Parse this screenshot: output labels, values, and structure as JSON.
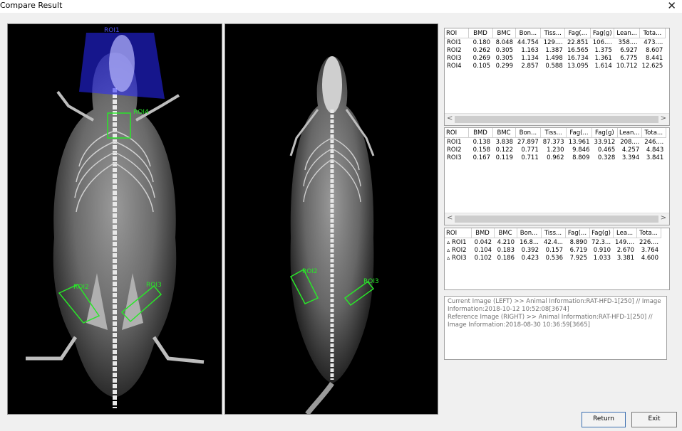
{
  "window": {
    "title": "Compare Result",
    "close_glyph": "✕"
  },
  "images": {
    "left_rois": [
      "ROI1",
      "ROI2",
      "ROI3",
      "ROI4"
    ],
    "right_rois": [
      "ROI2",
      "ROI3"
    ]
  },
  "tables": [
    {
      "columns": [
        "ROI",
        "BMD",
        "BMC",
        "Bon...",
        "Tiss...",
        "Fag(...",
        "Fag(g)",
        "Lean...",
        "Tota..."
      ],
      "rows": [
        [
          "ROI1",
          "0.180",
          "8.048",
          "44.754",
          "129....",
          "22.851",
          "106....",
          "358....",
          "473...."
        ],
        [
          "ROI2",
          "0.262",
          "0.305",
          "1.163",
          "1.387",
          "16.565",
          "1.375",
          "6.927",
          "8.607"
        ],
        [
          "ROI3",
          "0.269",
          "0.305",
          "1.134",
          "1.498",
          "16.734",
          "1.361",
          "6.775",
          "8.441"
        ],
        [
          "ROI4",
          "0.105",
          "0.299",
          "2.857",
          "0.588",
          "13.095",
          "1.614",
          "10.712",
          "12.625"
        ]
      ]
    },
    {
      "columns": [
        "ROI",
        "BMD",
        "BMC",
        "Bon...",
        "Tiss...",
        "Fag(...",
        "Fag(g)",
        "Lean...",
        "Tota..."
      ],
      "rows": [
        [
          "ROI1",
          "0.138",
          "3.838",
          "27.897",
          "87.373",
          "13.961",
          "33.912",
          "208....",
          "246...."
        ],
        [
          "ROI2",
          "0.158",
          "0.122",
          "0.771",
          "1.230",
          "9.846",
          "0.465",
          "4.257",
          "4.843"
        ],
        [
          "ROI3",
          "0.167",
          "0.119",
          "0.711",
          "0.962",
          "8.809",
          "0.328",
          "3.394",
          "3.841"
        ]
      ]
    },
    {
      "columns": [
        "ROI",
        "BMD",
        "BMC",
        "Bon...",
        "Tiss...",
        "Fag(...",
        "Fag(g)",
        "Lea...",
        "Tota..."
      ],
      "rows": [
        [
          "▵ ROI1",
          "0.042",
          "4.210",
          "16.8...",
          "42.4...",
          "8.890",
          "72.3...",
          "149....",
          "226...."
        ],
        [
          "▵ ROI2",
          "0.104",
          "0.183",
          "0.392",
          "0.157",
          "6.719",
          "0.910",
          "2.670",
          "3.764"
        ],
        [
          "▵ ROI3",
          "0.102",
          "0.186",
          "0.423",
          "0.536",
          "7.925",
          "1.033",
          "3.381",
          "4.600"
        ]
      ]
    }
  ],
  "scroll": {
    "left_arrow": "<",
    "right_arrow": ">"
  },
  "info": {
    "line1": "Current Image (LEFT) >>  Animal Information:RAT-HFD-1[250] // Image Information:2018-10-12 10:52:08[3674]",
    "line2": "Reference Image (RIGHT) >>  Animal Information:RAT-HFD-1[250] // Image Information:2018-08-30 10:36:59[3665]"
  },
  "buttons": {
    "return": "Return",
    "exit": "Exit"
  },
  "colors": {
    "roi_green": "#29e629",
    "roi1_blue": "#2828ff"
  }
}
